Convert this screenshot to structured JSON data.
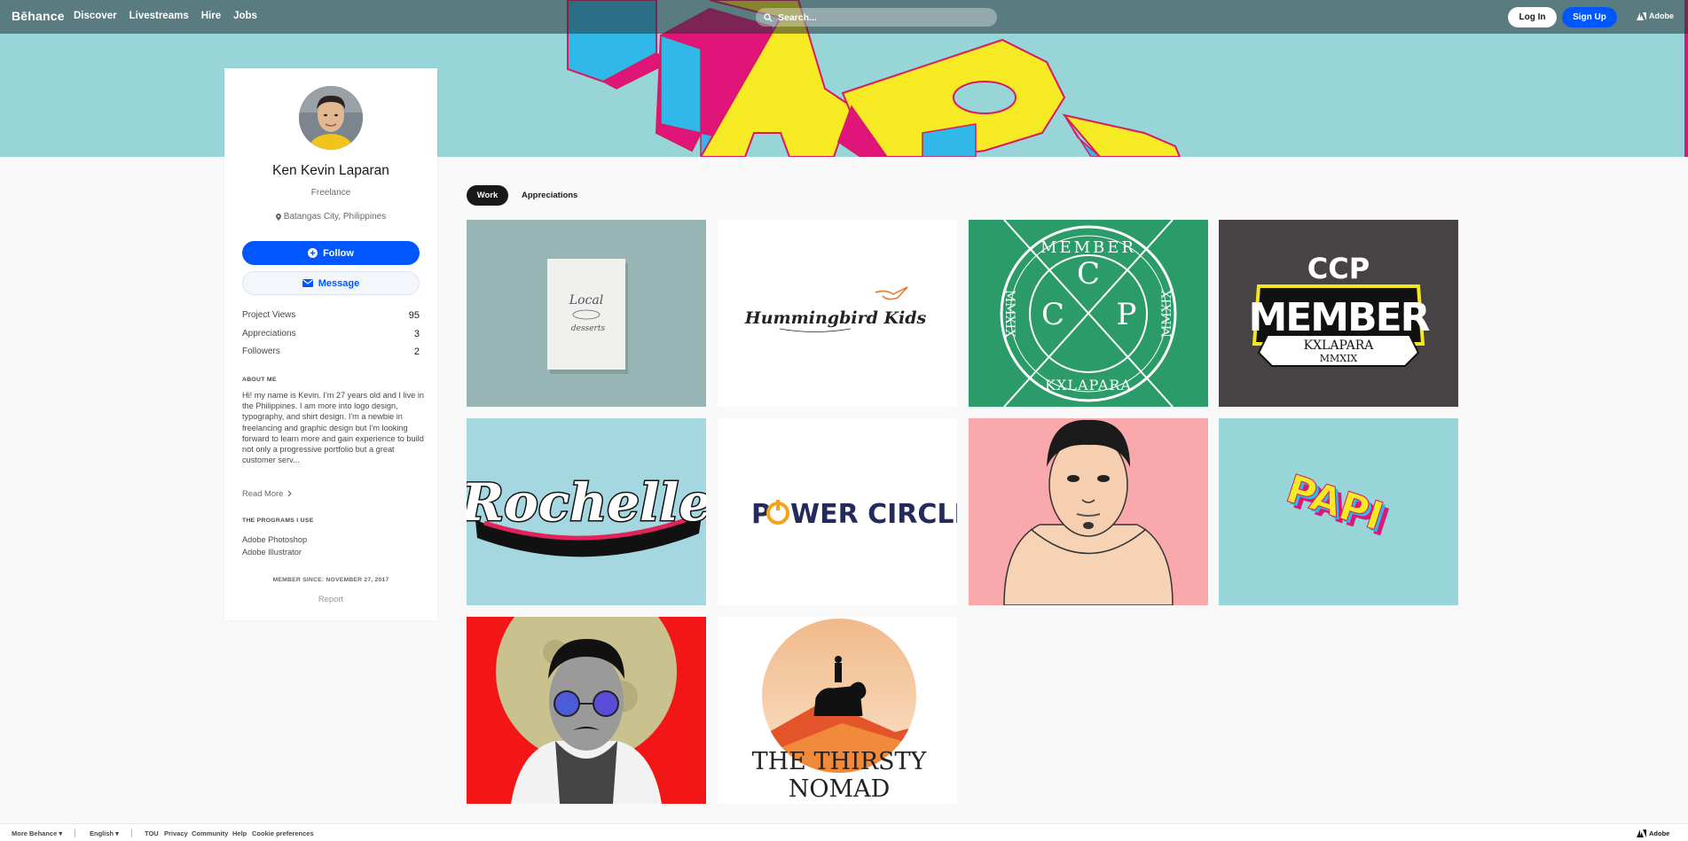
{
  "nav": {
    "logo": "Bēhance",
    "links": [
      "Discover",
      "Livestreams",
      "Hire",
      "Jobs"
    ],
    "search_placeholder": "Search...",
    "login": "Log In",
    "signup": "Sign Up",
    "adobe": "Adobe"
  },
  "banner": {
    "text": "PAPI"
  },
  "profile": {
    "name": "Ken Kevin Laparan",
    "occupation": "Freelance",
    "location": "Batangas City, Philippines",
    "follow": "Follow",
    "message": "Message",
    "stats": [
      {
        "label": "Project Views",
        "value": "95"
      },
      {
        "label": "Appreciations",
        "value": "3"
      },
      {
        "label": "Followers",
        "value": "2"
      }
    ],
    "about_title": "ABOUT ME",
    "about_text": "Hi! my name is Kevin. I'm 27 years old and I live in the Philippines. I am more into logo design, typography, and shirt design. I'm a newbie in freelancing and graphic design but I'm looking forward to learn more and gain experience to build not only a progressive portfolio but a great customer serv...",
    "read_more": "Read More",
    "programs_title": "THE PROGRAMS I USE",
    "programs": [
      "Adobe Photoshop",
      "Adobe Illustrator"
    ],
    "member_since": "MEMBER SINCE: NOVEMBER 27, 2017",
    "report": "Report"
  },
  "tabs": {
    "work": "Work",
    "appreciations": "Appreciations"
  },
  "projects": [
    {
      "name": "project-local-desserts",
      "text": [
        "Local",
        "desserts"
      ],
      "bg": "#97b5b5"
    },
    {
      "name": "project-hummingbird-kids",
      "text": [
        "Hummingbird Kids"
      ],
      "bg": "#ffffff"
    },
    {
      "name": "project-ccp-member-badge",
      "text": [
        "MEMBER",
        "C",
        "C",
        "P",
        "KXLAPARA",
        "MMXIX",
        "MMXIX"
      ],
      "bg": "#2a9b69"
    },
    {
      "name": "project-ccp-member-logo",
      "text": [
        "CCP",
        "MEMBER",
        "KXLAPARA",
        "MMXIX"
      ],
      "bg": "#474243"
    },
    {
      "name": "project-rochelle",
      "text": [
        "Rochelle"
      ],
      "bg": "#a5d7e0"
    },
    {
      "name": "project-power-circle",
      "text": [
        "P",
        "WER CIRCLE"
      ],
      "bg": "#ffffff"
    },
    {
      "name": "project-portrait-hoodie",
      "text": [],
      "bg": "#f9a8ac"
    },
    {
      "name": "project-papi",
      "text": [
        "PAPI"
      ],
      "bg": "#97d5d8"
    },
    {
      "name": "project-moon-portrait",
      "text": [],
      "bg": "#f21716"
    },
    {
      "name": "project-thirsty-nomad",
      "text": [
        "THE THIRSTY",
        "NOMAD"
      ],
      "bg": "#ffffff"
    }
  ],
  "footer": {
    "more": "More Behance",
    "language": "English",
    "links": [
      "TOU",
      "Privacy",
      "Community",
      "Help",
      "Cookie preferences"
    ],
    "adobe": "Adobe"
  }
}
